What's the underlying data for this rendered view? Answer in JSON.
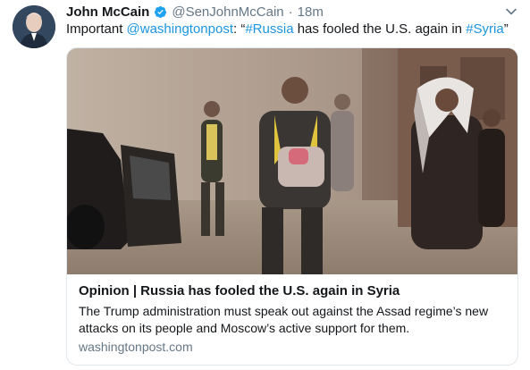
{
  "tweet": {
    "author_name": "John McCain",
    "author_handle": "@SenJohnMcCain",
    "separator": "·",
    "time": "18m",
    "text_parts": [
      {
        "text": "Important ",
        "link": false
      },
      {
        "text": "@washingtonpost",
        "link": true
      },
      {
        "text": ": “",
        "link": false
      },
      {
        "text": "#Russia",
        "link": true
      },
      {
        "text": " has fooled the U.S. again in ",
        "link": false
      },
      {
        "text": "#Syria",
        "link": true
      },
      {
        "text": "”",
        "link": false
      }
    ]
  },
  "card": {
    "title": "Opinion | Russia has fooled the U.S. again in Syria",
    "description": "The Trump administration must speak out against the Assad regime’s new attacks on its people and Moscow’s active support for them.",
    "domain": "washingtonpost.com"
  },
  "icons": {
    "avatar": "profile-photo",
    "verified": "verified-badge-icon",
    "menu": "chevron-down-icon"
  },
  "colors": {
    "link": "#1b95e0",
    "secondary_text": "#657786",
    "verified": "#1da1f2",
    "card_border": "#e1e8ed"
  }
}
